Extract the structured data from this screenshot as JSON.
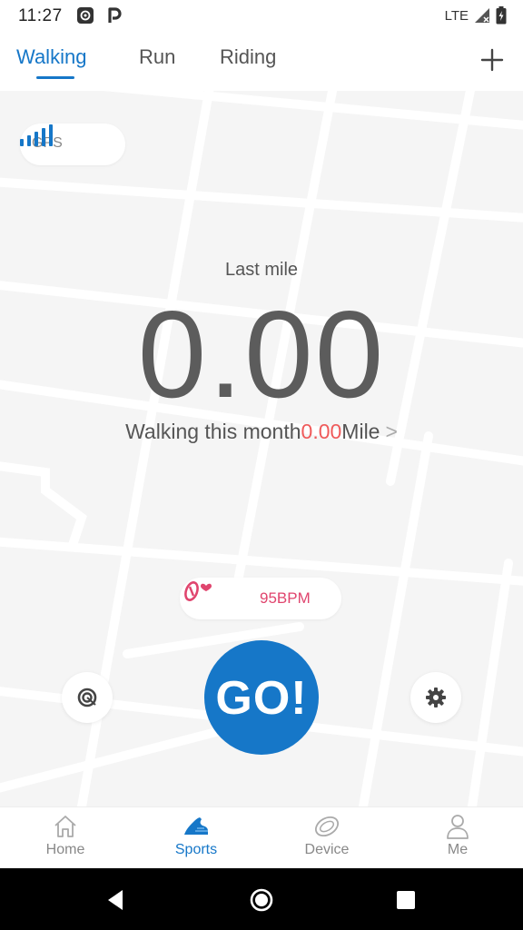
{
  "status_bar": {
    "time": "11:27",
    "network": "LTE"
  },
  "tabs": {
    "items": [
      {
        "label": "Walking",
        "active": true
      },
      {
        "label": "Run",
        "active": false
      },
      {
        "label": "Riding",
        "active": false
      }
    ],
    "add_icon": "plus-icon"
  },
  "map": {
    "gps_label": "GPS",
    "gps_signal_bars": 4,
    "last_mile_label": "Last mile",
    "distance": "0.00",
    "month_prefix": "Walking this month",
    "month_value": "0.00",
    "month_unit": "Mile",
    "month_chevron": ">",
    "heart_rate": "95BPM",
    "go_label": "GO!",
    "accent_color": "#1677c8",
    "highlight_color": "#ef5a5a"
  },
  "bottom_nav": {
    "items": [
      {
        "label": "Home",
        "icon": "home-icon",
        "active": false
      },
      {
        "label": "Sports",
        "icon": "shoe-icon",
        "active": true
      },
      {
        "label": "Device",
        "icon": "band-icon",
        "active": false
      },
      {
        "label": "Me",
        "icon": "person-icon",
        "active": false
      }
    ]
  }
}
